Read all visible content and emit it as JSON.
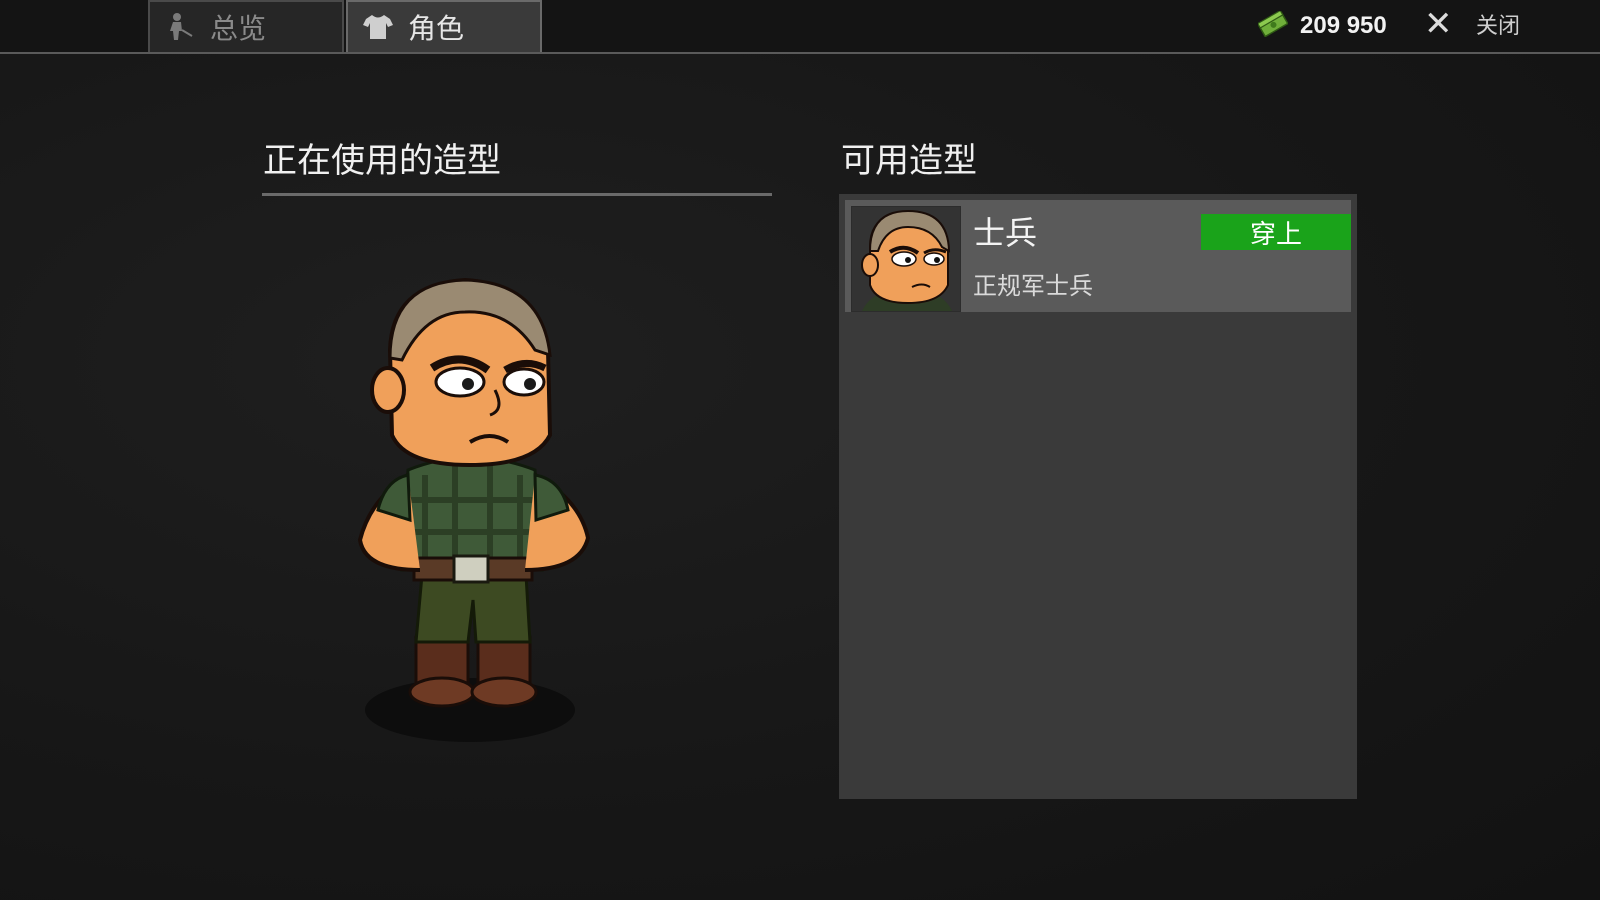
{
  "tabs": [
    {
      "label": "总览",
      "icon": "person-icon",
      "active": false
    },
    {
      "label": "角色",
      "icon": "shirt-icon",
      "active": true
    }
  ],
  "header": {
    "money": "209 950",
    "money_icon": "cash-icon",
    "close_label": "关闭"
  },
  "current": {
    "title": "正在使用的造型"
  },
  "available": {
    "title": "可用造型",
    "items": [
      {
        "name": "士兵",
        "description": "正规军士兵",
        "button": "穿上"
      }
    ]
  },
  "colors": {
    "accent_green": "#1aa31a",
    "panel": "#3a3a3a",
    "card": "#5a5a5a"
  }
}
